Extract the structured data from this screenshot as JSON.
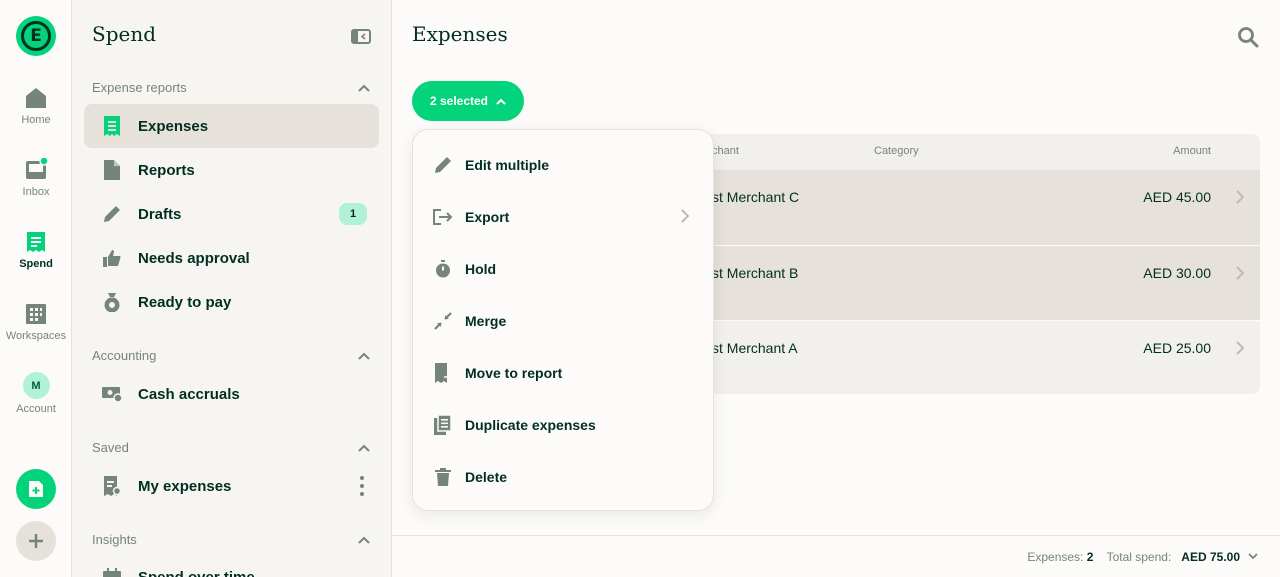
{
  "rail": {
    "logo_letter": "E",
    "items": [
      {
        "label": "Home",
        "icon": "home-icon"
      },
      {
        "label": "Inbox",
        "icon": "inbox-icon"
      },
      {
        "label": "Spend",
        "icon": "receipt-icon"
      },
      {
        "label": "Workspaces",
        "icon": "building-icon"
      },
      {
        "label": "Account",
        "icon": "avatar"
      }
    ],
    "account_initial": "M"
  },
  "sidebar": {
    "title": "Spend",
    "sections": [
      {
        "label": "Expense reports"
      },
      {
        "label": "Accounting"
      },
      {
        "label": "Saved"
      },
      {
        "label": "Insights"
      }
    ],
    "items": [
      {
        "label": "Expenses",
        "icon": "receipt-icon"
      },
      {
        "label": "Reports",
        "icon": "document-icon"
      },
      {
        "label": "Drafts",
        "icon": "pencil-icon",
        "badge": "1"
      },
      {
        "label": "Needs approval",
        "icon": "thumbs-up-icon"
      },
      {
        "label": "Ready to pay",
        "icon": "money-bag-icon"
      },
      {
        "label": "Cash accruals",
        "icon": "cash-icon"
      },
      {
        "label": "My expenses",
        "icon": "saved-search-icon"
      },
      {
        "label": "Spend over time",
        "icon": "calendar-icon"
      }
    ]
  },
  "main": {
    "title": "Expenses",
    "selected_label": "2 selected",
    "columns": {
      "merchant": "chant",
      "category": "Category",
      "amount": "Amount"
    },
    "rows": [
      {
        "merchant": "st Merchant C",
        "amount": "AED 45.00"
      },
      {
        "merchant": "st Merchant B",
        "amount": "AED 30.00"
      },
      {
        "merchant": "st Merchant A",
        "amount": "AED 25.00"
      }
    ],
    "footer": {
      "expenses_label": "Expenses:",
      "expenses_count": "2",
      "total_label": "Total spend:",
      "total_value": "AED 75.00"
    }
  },
  "menu": {
    "items": [
      {
        "label": "Edit multiple",
        "icon": "pencil-icon"
      },
      {
        "label": "Export",
        "icon": "export-icon"
      },
      {
        "label": "Hold",
        "icon": "stopwatch-icon"
      },
      {
        "label": "Merge",
        "icon": "merge-icon"
      },
      {
        "label": "Move to report",
        "icon": "move-to-report-icon"
      },
      {
        "label": "Duplicate expenses",
        "icon": "duplicate-icon"
      },
      {
        "label": "Delete",
        "icon": "trash-icon"
      }
    ]
  },
  "colors": {
    "accent": "#03d47c",
    "text": "#002e22",
    "muted": "#76847e",
    "selected_row": "#e6e1da"
  }
}
